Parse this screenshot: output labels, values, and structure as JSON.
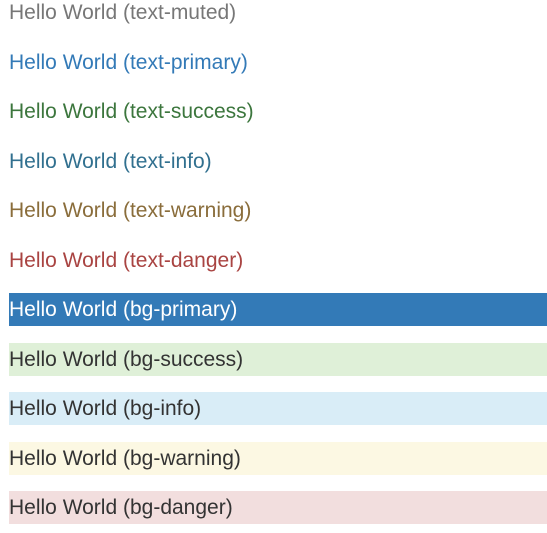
{
  "text_rows": {
    "muted": "Hello World (text-muted)",
    "primary": "Hello World (text-primary)",
    "success": "Hello World (text-success)",
    "info": "Hello World (text-info)",
    "warning": "Hello World (text-warning)",
    "danger": "Hello World (text-danger)"
  },
  "bg_rows": {
    "primary": "Hello World (bg-primary)",
    "success": "Hello World (bg-success)",
    "info": "Hello World (bg-info)",
    "warning": "Hello World (bg-warning)",
    "danger": "Hello World (bg-danger)"
  },
  "colors": {
    "text_muted": "#777777",
    "text_primary": "#337ab7",
    "text_success": "#3c763d",
    "text_info": "#31708f",
    "text_warning": "#8a6d3b",
    "text_danger": "#a94442",
    "bg_primary": "#337ab7",
    "bg_success": "#dff0d8",
    "bg_info": "#d9edf7",
    "bg_warning": "#fcf8e3",
    "bg_danger": "#f2dede"
  }
}
